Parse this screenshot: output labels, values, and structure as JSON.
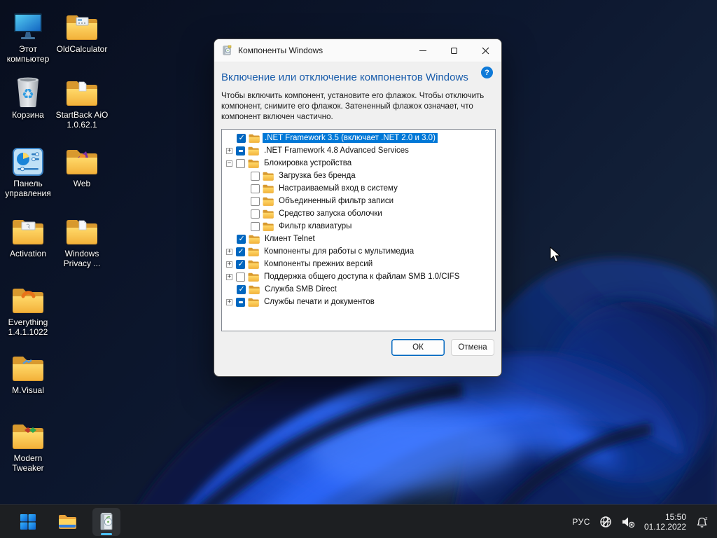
{
  "colors": {
    "selection_blue": "#0078d7",
    "checkbox_blue": "#0067c0",
    "heading_blue": "#1a5dab",
    "help_blue": "#0f7ad8",
    "taskbar_indicator": "#4cc2ff"
  },
  "desktop": {
    "icons": [
      {
        "label": "Этот компьютер",
        "icon": "computer"
      },
      {
        "label": "OldCalculator",
        "icon": "folder-calculator"
      },
      {
        "label": "Корзина",
        "icon": "recycle-bin"
      },
      {
        "label": "StartBack AiO 1.0.62.1",
        "icon": "folder-paper"
      },
      {
        "label": "Панель управления",
        "icon": "control-panel"
      },
      {
        "label": "Web",
        "icon": "folder-web"
      },
      {
        "label": "Activation",
        "icon": "folder-paper"
      },
      {
        "label": "Windows Privacy ...",
        "icon": "folder-paper"
      },
      {
        "label": "Everything 1.4.1.1022",
        "icon": "folder-arc"
      },
      {
        "label": "M.Visual",
        "icon": "folder-paper"
      },
      {
        "label": "Modern Tweaker",
        "icon": "folder-shapes"
      }
    ]
  },
  "dialog": {
    "title": "Компоненты Windows",
    "heading": "Включение или отключение компонентов Windows",
    "help_label": "?",
    "description": "Чтобы включить компонент, установите его флажок. Чтобы отключить компонент, снимите его флажок. Затененный флажок означает, что компонент включен частично.",
    "tree": [
      {
        "label": ".NET Framework 3.5 (включает .NET 2.0 и 3.0)",
        "state": "checked",
        "selected": true,
        "level": 0,
        "expander": ""
      },
      {
        "label": ".NET Framework 4.8 Advanced Services",
        "state": "partial",
        "selected": false,
        "level": 0,
        "expander": "+"
      },
      {
        "label": "Блокировка устройства",
        "state": "unchecked",
        "selected": false,
        "level": 0,
        "expander": "−"
      },
      {
        "label": "Загрузка без бренда",
        "state": "unchecked",
        "selected": false,
        "level": 1,
        "expander": ""
      },
      {
        "label": "Настраиваемый вход в систему",
        "state": "unchecked",
        "selected": false,
        "level": 1,
        "expander": ""
      },
      {
        "label": "Объединенный фильтр записи",
        "state": "unchecked",
        "selected": false,
        "level": 1,
        "expander": ""
      },
      {
        "label": "Средство запуска оболочки",
        "state": "unchecked",
        "selected": false,
        "level": 1,
        "expander": ""
      },
      {
        "label": "Фильтр клавиатуры",
        "state": "unchecked",
        "selected": false,
        "level": 1,
        "expander": ""
      },
      {
        "label": "Клиент Telnet",
        "state": "checked",
        "selected": false,
        "level": 0,
        "expander": ""
      },
      {
        "label": "Компоненты для работы с мультимедиа",
        "state": "checked",
        "selected": false,
        "level": 0,
        "expander": "+"
      },
      {
        "label": "Компоненты прежних версий",
        "state": "checked",
        "selected": false,
        "level": 0,
        "expander": "+"
      },
      {
        "label": "Поддержка общего доступа к файлам SMB 1.0/CIFS",
        "state": "unchecked",
        "selected": false,
        "level": 0,
        "expander": "+"
      },
      {
        "label": "Служба SMB Direct",
        "state": "checked",
        "selected": false,
        "level": 0,
        "expander": ""
      },
      {
        "label": "Службы печати и документов",
        "state": "partial",
        "selected": false,
        "level": 0,
        "expander": "+"
      }
    ],
    "buttons": {
      "ok": "ОК",
      "cancel": "Отмена"
    }
  },
  "taskbar": {
    "tray": {
      "language": "РУС",
      "time": "15:50",
      "date": "01.12.2022"
    }
  }
}
